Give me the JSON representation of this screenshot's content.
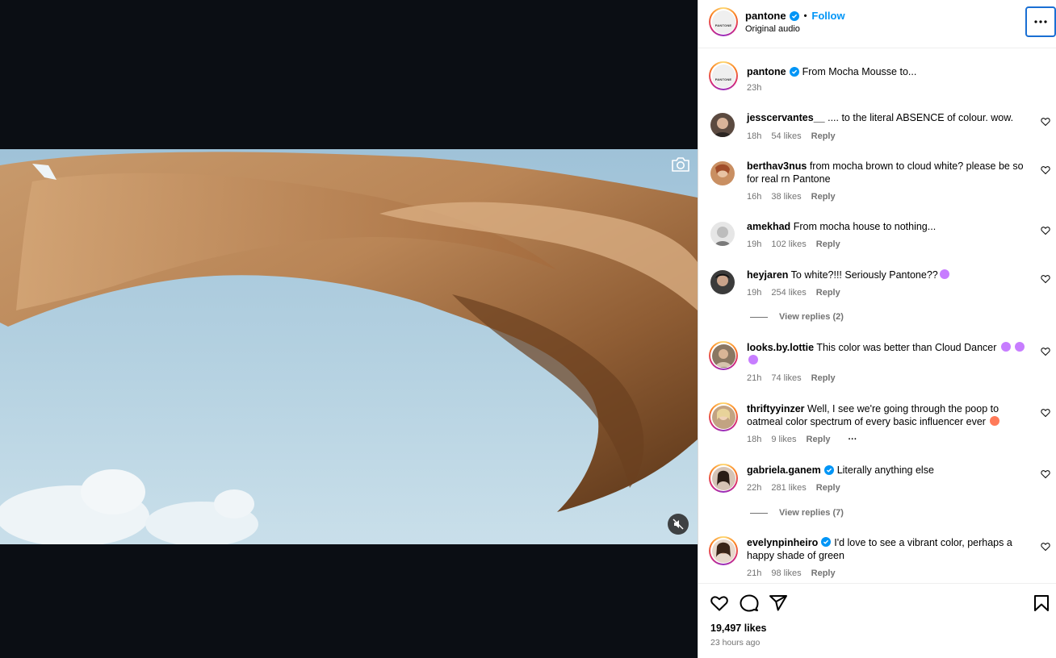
{
  "post": {
    "username": "pantone",
    "dot": "•",
    "follow_label": "Follow",
    "audio": "Original audio",
    "avatar_text": "PANTONE"
  },
  "caption": {
    "username": "pantone",
    "text": "From Mocha Mousse to...",
    "time": "23h"
  },
  "comments": [
    {
      "username": "jesscervantes__",
      "text": ".... to the literal ABSENCE of colour. wow.",
      "time": "18h",
      "likes": "54 likes",
      "reply": "Reply"
    },
    {
      "username": "berthav3nus",
      "text": "from mocha brown to cloud white? please be so for real rn Pantone",
      "time": "16h",
      "likes": "38 likes",
      "reply": "Reply"
    },
    {
      "username": "amekhad",
      "text": "From mocha house to nothing...",
      "time": "19h",
      "likes": "102 likes",
      "reply": "Reply"
    },
    {
      "username": "heyjaren",
      "text": "To white?!!! Seriously Pantone??",
      "time": "19h",
      "likes": "254 likes",
      "reply": "Reply",
      "view_replies": "View replies (2)"
    },
    {
      "username": "looks.by.lottie",
      "text": "This color was better than Cloud Dancer",
      "time": "21h",
      "likes": "74 likes",
      "reply": "Reply"
    },
    {
      "username": "thriftyyinzer",
      "text": "Well, I see we're going through the poop to oatmeal color spectrum of every basic influencer ever",
      "time": "18h",
      "likes": "9 likes",
      "reply": "Reply",
      "more": "···"
    },
    {
      "username": "gabriela.ganem",
      "text": "Literally anything else",
      "time": "22h",
      "likes": "281 likes",
      "reply": "Reply",
      "view_replies": "View replies (7)"
    },
    {
      "username": "evelynpinheiro",
      "text": "I'd love to see a vibrant color, perhaps a happy shade of green",
      "time": "21h",
      "likes": "98 likes",
      "reply": "Reply"
    }
  ],
  "footer": {
    "likes": "19,497 likes",
    "time": "23 hours ago"
  },
  "colors": {
    "accent": "#0095f6",
    "verified": "#0095f6",
    "muted": "#737373",
    "media_bg": "#0b0e14"
  },
  "icons": [
    "camera-icon",
    "mute-icon",
    "more-icon",
    "verified-icon",
    "heart-icon",
    "comment-icon",
    "share-icon",
    "bookmark-icon"
  ]
}
